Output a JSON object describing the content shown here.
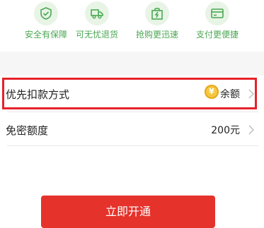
{
  "benefits": [
    {
      "label": "安全有保障",
      "icon": "shield-check-icon"
    },
    {
      "label": "可无忧退货",
      "icon": "truck-return-icon"
    },
    {
      "label": "抢购更迅速",
      "icon": "shopping-bag-bolt-icon"
    },
    {
      "label": "支付更便捷",
      "icon": "credit-card-icon"
    }
  ],
  "settings": {
    "priority_payment": {
      "label": "优先扣款方式",
      "value": "余额",
      "coin_symbol": "¥"
    },
    "password_free_limit": {
      "label": "免密额度",
      "value": "200元"
    }
  },
  "primary_button": {
    "label": "立即开通"
  },
  "colors": {
    "accent_green": "#4aa852",
    "highlight_red": "#e5222a",
    "button_red": "#e5322b"
  }
}
